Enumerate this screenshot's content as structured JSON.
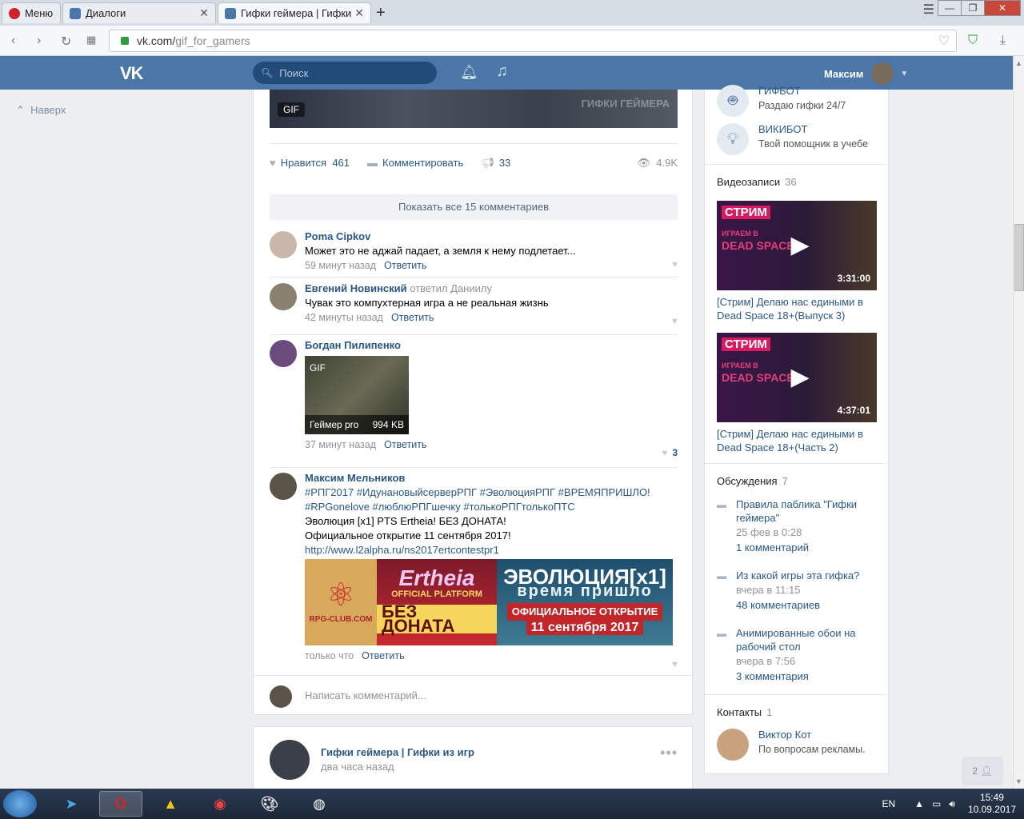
{
  "browser": {
    "tabs": [
      {
        "label": "Меню"
      },
      {
        "label": "Диалоги"
      },
      {
        "label": "Гифки геймера | Гифки из"
      }
    ],
    "url_host": "vk.com/",
    "url_path": "gif_for_gamers"
  },
  "header": {
    "logo": "VK",
    "search_placeholder": "Поиск",
    "user_name": "Максим"
  },
  "left": {
    "up_label": "Наверх"
  },
  "post": {
    "gif_badge": "GIF",
    "gif_watermark": "ГИФКИ ГЕЙМЕРА",
    "like_label": "Нравится",
    "like_count": "461",
    "comment_label": "Комментировать",
    "share_count": "33",
    "views": "4.9K",
    "show_all": "Показать все 15 комментариев",
    "comments": [
      {
        "author": "Poma Cipkov",
        "reply_to": "",
        "text": "Может это не аджай падает, а земля к нему подлетает...",
        "time": "59 минут назад",
        "reply": "Ответить",
        "likes": ""
      },
      {
        "author": "Евгений Новинский",
        "reply_to": "ответил Даниилу",
        "text": "Чувак это компухтерная игра а не реальная жизнь",
        "time": "42 минуты назад",
        "reply": "Ответить",
        "likes": ""
      },
      {
        "author": "Богдан Пилипенко",
        "reply_to": "",
        "text": "",
        "gif_badge": "GIF",
        "gif_caption": "Геймер pro",
        "gif_size": "994 KB",
        "time": "37 минут назад",
        "reply": "Ответить",
        "likes": "3"
      },
      {
        "author": "Максим Мельников",
        "reply_to": "",
        "tags1": "#РПГ2017 #ИдунановыйсерверРПГ #ЭволюцияРПГ #ВРЕМЯПРИШЛО!",
        "tags2": "#RPGonelove #люблюРПГшечку #толькоРПГтолькоПТС",
        "line1": "Эволюция [x1] PTS Ertheia! БЕЗ ДОНАТА!",
        "line2": "Официальное открытие 11 сентября 2017!",
        "link": "http://www.l2alpha.ru/ns2017ertcontestpr1",
        "time": "только что",
        "reply": "Ответить",
        "likes": ""
      }
    ],
    "banner": {
      "rpg": "RPG-CLUB.COM",
      "ertheia": "Ertheia",
      "official": "OFFICIAL PLATFORM",
      "no_donate": "БЕЗ ДОНАТА",
      "evo": "ЭВОЛЮЦИЯ[x1]",
      "time": "время пришло",
      "open": "ОФИЦИАЛЬНОЕ ОТКРЫТИЕ",
      "date": "11 сентября 2017"
    },
    "write_placeholder": "Написать комментарий..."
  },
  "post2": {
    "author": "Гифки геймера | Гифки из игр",
    "time": "два часа назад"
  },
  "side": {
    "bots": [
      {
        "name": "ГИФБОТ",
        "desc": "Раздаю гифки 24/7"
      },
      {
        "name": "ВИКИБОТ",
        "desc": "Твой помощник в учебе"
      }
    ],
    "videos_title": "Видеозаписи",
    "videos_count": "36",
    "videos": [
      {
        "stream": "СТРИМ",
        "small": "ИГРАЕМ В",
        "game": "DEAD SPACE",
        "duration": "3:31:00",
        "title": "[Стрим] Делаю нас едиными в Dead Space 18+(Выпуск 3)"
      },
      {
        "stream": "СТРИМ",
        "small": "ИГРАЕМ В",
        "game": "DEAD SPACE",
        "duration": "4:37:01",
        "title": "[Стрим] Делаю нас едиными в Dead Space 18+(Часть 2)"
      }
    ],
    "disc_title": "Обсуждения",
    "disc_count": "7",
    "discussions": [
      {
        "title": "Правила паблика \"Гифки геймера\"",
        "date": "25 фев в 0:28",
        "comments": "1 комментарий"
      },
      {
        "title": "Из какой игры эта гифка?",
        "date": "вчера в 11:15",
        "comments": "48 комментариев"
      },
      {
        "title": "Анимированные обои на рабочий стол",
        "date": "вчера в 7:56",
        "comments": "3 комментария"
      }
    ],
    "contacts_title": "Контакты",
    "contacts_count": "1",
    "contact": {
      "name": "Виктор Кот",
      "role": "По вопросам рекламы."
    }
  },
  "chat_count": "2",
  "taskbar": {
    "lang": "EN",
    "time": "15:49",
    "date": "10.09.2017"
  }
}
